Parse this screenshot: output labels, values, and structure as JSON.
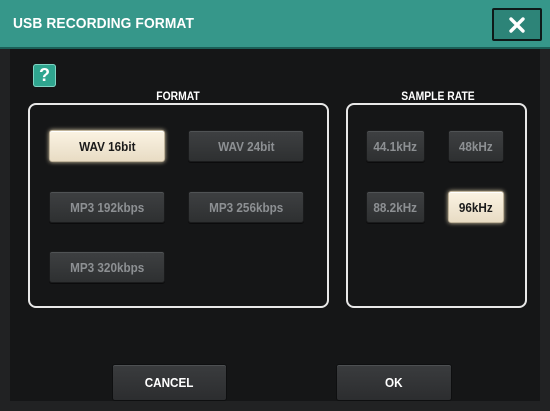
{
  "dialog": {
    "title": "USB RECORDING FORMAT",
    "close_icon": "close-icon",
    "help_label": "?"
  },
  "format": {
    "label": "FORMAT",
    "options": [
      {
        "label": "WAV 16bit",
        "selected": true
      },
      {
        "label": "WAV 24bit",
        "selected": false
      },
      {
        "label": "MP3 192kbps",
        "selected": false
      },
      {
        "label": "MP3 256kbps",
        "selected": false
      },
      {
        "label": "MP3 320kbps",
        "selected": false
      }
    ]
  },
  "sample_rate": {
    "label": "SAMPLE RATE",
    "options": [
      {
        "label": "44.1kHz",
        "selected": false
      },
      {
        "label": "48kHz",
        "selected": false
      },
      {
        "label": "88.2kHz",
        "selected": false
      },
      {
        "label": "96kHz",
        "selected": true
      }
    ]
  },
  "actions": {
    "cancel_label": "CANCEL",
    "ok_label": "OK"
  },
  "colors": {
    "title_bar": "#36978a",
    "selected_button": "#f6eddb",
    "unselected_button": "#35373a"
  }
}
